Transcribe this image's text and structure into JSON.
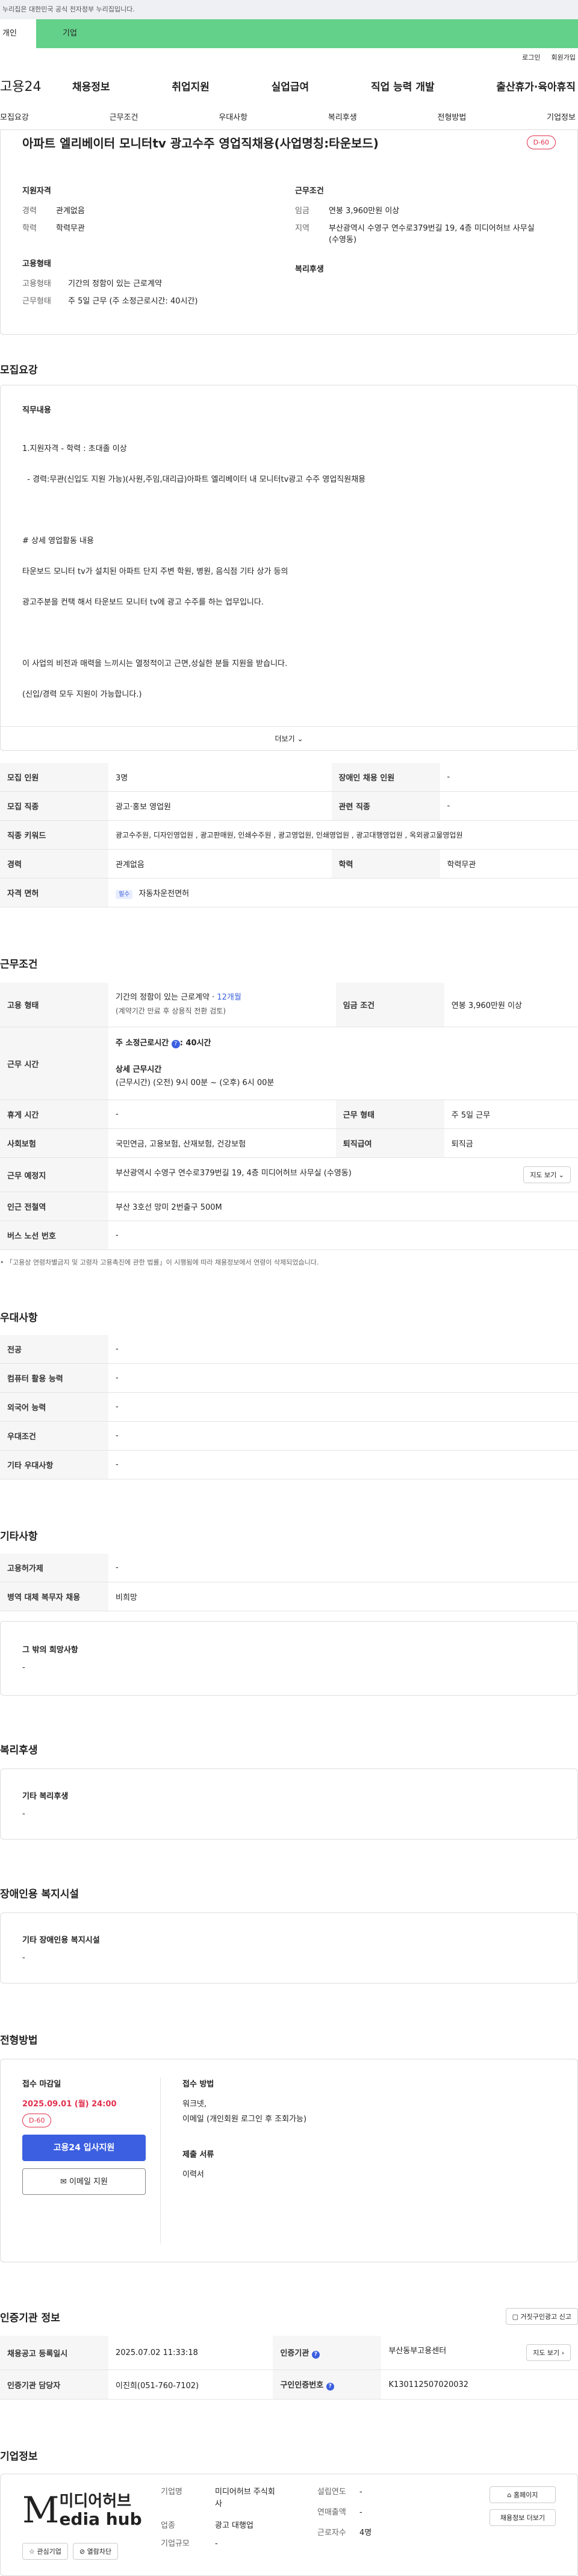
{
  "banner": {
    "text": "누리집은 대한민국 공식 전자정부 누리집입니다."
  },
  "tabs": {
    "person": "개인",
    "company": "기업"
  },
  "util": {
    "login": "로그인",
    "join": "회원가입"
  },
  "gnb": {
    "logo": "고용24",
    "menu": [
      "채용정보",
      "취업지원",
      "실업급여",
      "직업 능력 개발",
      "출산휴가·육아휴직"
    ]
  },
  "anchors": [
    "모집요강",
    "근무조건",
    "우대사항",
    "복리후생",
    "전형방법",
    "기업정보"
  ],
  "job": {
    "title": "아파트 엘리베이터 모니터tv 광고수주 영업직채용(사업명칭:타운보드)",
    "dday": "D-60"
  },
  "summary": {
    "qual_title": "지원자격",
    "qual": [
      {
        "k": "경력",
        "v": "관계없음"
      },
      {
        "k": "학력",
        "v": "학력무관"
      }
    ],
    "cond_title": "근무조건",
    "cond": [
      {
        "k": "임금",
        "v": "연봉 3,960만원 이상"
      },
      {
        "k": "지역",
        "v": "부산광역시 수영구 연수로379번길 19, 4층 미디어허브 사무실 (수영동)"
      }
    ],
    "emp_title": "고용형태",
    "emp": [
      {
        "k": "고용형태",
        "v": "기간의 정함이 있는 근로계약"
      },
      {
        "k": "근무형태",
        "v": "주 5일 근무 (주 소정근로시간: 40시간)"
      }
    ],
    "wel_title": "복리후생"
  },
  "recruit": {
    "title": "모집요강",
    "duty_title": "직무내용",
    "duty_lines": [
      "1.지원자격 - 학력 : 초대졸 이상",
      "  - 경력:무관(신입도 지원 가능)(사원,주임,대리급)아파트 엘리베이터 내 모니터tv광고 수주 영업직원채용",
      "",
      "# 상세 영업활동 내용",
      "타운보드 모니터 tv가 설치된 아파트 단지 주변 학원, 병원, 음식점 기타 상가 등의",
      "광고주분을 컨택 해서 타운보드 모니터 tv에 광고 수주를 하는 업무입니다.",
      "",
      "이 사업의 비전과 매력을 느끼시는 열정적이고 근면,성실한 분들 지원을 받습니다.",
      "(신입/경력 모두 지원이 가능합니다.)"
    ],
    "more": "더보기",
    "rows": [
      {
        "k1": "모집 인원",
        "v1": "3명",
        "k2": "장애인 채용 인원",
        "v2": "-"
      },
      {
        "k1": "모집 직종",
        "v1": "광고·홍보 영업원",
        "k2": "관련 직종",
        "v2": "-"
      },
      {
        "k1": "직종 키워드",
        "v1": "광고수주원, 디자인영업원 , 광고판매원, 인쇄수주원 , 광고영업원, 인쇄영업원 , 광고대행영업원 , 옥외광고물영업원"
      },
      {
        "k1": "경력",
        "v1": "관계없음",
        "k2": "학력",
        "v2": "학력무관"
      },
      {
        "k1": "자격 면허",
        "tag": "필수",
        "v1": "자동차운전면허"
      }
    ]
  },
  "work": {
    "title": "근무조건",
    "emp_k": "고용 형태",
    "emp_v1": "기간의 정함이 있는 근로계약 · ",
    "emp_v1b": "12개월",
    "emp_v2": "(계약기간 만료 후 상용직 전환 검토)",
    "wage_k": "임금 조건",
    "wage_v": "연봉 3,960만원 이상",
    "hours_k": "근무 시간",
    "hours_v1": "주 소정근로시간 ",
    "hours_v1b": ": 40시간",
    "hours_v2": "상세 근무시간",
    "hours_v3": "(근무시간) (오전) 9시 00분 ~ (오후) 6시 00분",
    "rest_k": "휴게 시간",
    "rest_v": "-",
    "type_k": "근무 형태",
    "type_v": "주 5일 근무",
    "ins_k": "사회보험",
    "ins_v": "국민연금, 고용보험, 산재보험, 건강보험",
    "ret_k": "퇴직급여",
    "ret_v": "퇴직금",
    "place_k": "근무 예정지",
    "place_v": "부산광역시 수영구 연수로379번길 19, 4층 미디어허브 사무실 (수영동)",
    "map": "지도 보기",
    "sub_k": "인근 전철역",
    "sub_v": "부산 3호선 망미 2번출구 500M",
    "bus_k": "버스 노선 번호",
    "bus_v": "-",
    "note": "「고용상 연령차별금지 및 고령자 고용촉진에 관한 법률」이 시행됨에 따라 채용정보에서 연령이 삭제되었습니다."
  },
  "pref": {
    "title": "우대사항",
    "rows": [
      {
        "k": "전공",
        "v": "-"
      },
      {
        "k": "컴퓨터 활용 능력",
        "v": "-"
      },
      {
        "k": "외국어 능력",
        "v": "-"
      },
      {
        "k": "우대조건",
        "v": "-"
      },
      {
        "k": "기타 우대사항",
        "v": "-"
      }
    ]
  },
  "other": {
    "title": "기타사항",
    "rows": [
      {
        "k": "고용허가제",
        "v": "-"
      },
      {
        "k": "병역 대체 복무자 채용",
        "v": "비희망"
      }
    ],
    "box_title": "그 밖의 희망사항",
    "box_v": "-"
  },
  "welfare": {
    "title": "복리후생",
    "box_title": "기타 복리후생",
    "box_v": "-"
  },
  "disabled": {
    "title": "장애인용 복지시설",
    "box_title": "기타 장애인용 복지시설",
    "box_v": "-"
  },
  "apply": {
    "title": "전형방법",
    "deadline_k": "접수 마감일",
    "deadline_v": "2025.09.01 (월) 24:00",
    "dday": "D-60",
    "apply_btn": "고용24 입사지원",
    "email_btn": "이메일 지원",
    "method_k": "접수 방법",
    "method_v1": "워크넷,",
    "method_v2": "이메일 (개인회원 로그인 후 조회가능)",
    "docs_k": "제출 서류",
    "docs_v": "이력서"
  },
  "cert": {
    "title": "인증기관 정보",
    "report": "거짓구인광고 신고",
    "rows": [
      {
        "k1": "채용공고 등록일시",
        "v1": "2025.07.02 11:33:18",
        "k2": "인증기관",
        "v2": "부산동부고용센터",
        "btn": "지도 보기"
      },
      {
        "k1": "인증기관 담당자",
        "v1": "이진희(051-760-7102)",
        "k2": "구인인증번호",
        "v2": "K130112507020032"
      }
    ]
  },
  "company": {
    "title": "기업정보",
    "logo_top": "미디어허브",
    "logo_bottom": "edia hub",
    "logo_m": "M",
    "fav": "관심기업",
    "block": "열람차단",
    "name_k": "기업명",
    "name_v": "미디어허브 주식회사",
    "ind_k": "업종",
    "ind_v": "광고 대행업",
    "size_k": "기업규모",
    "size_v": "-",
    "est_k": "설립연도",
    "est_v": "-",
    "sales_k": "연매출액",
    "sales_v": "-",
    "emp_k": "근로자수",
    "emp_v": "4명",
    "home": "홈페이지",
    "more_jobs": "채용정보 더보기"
  }
}
